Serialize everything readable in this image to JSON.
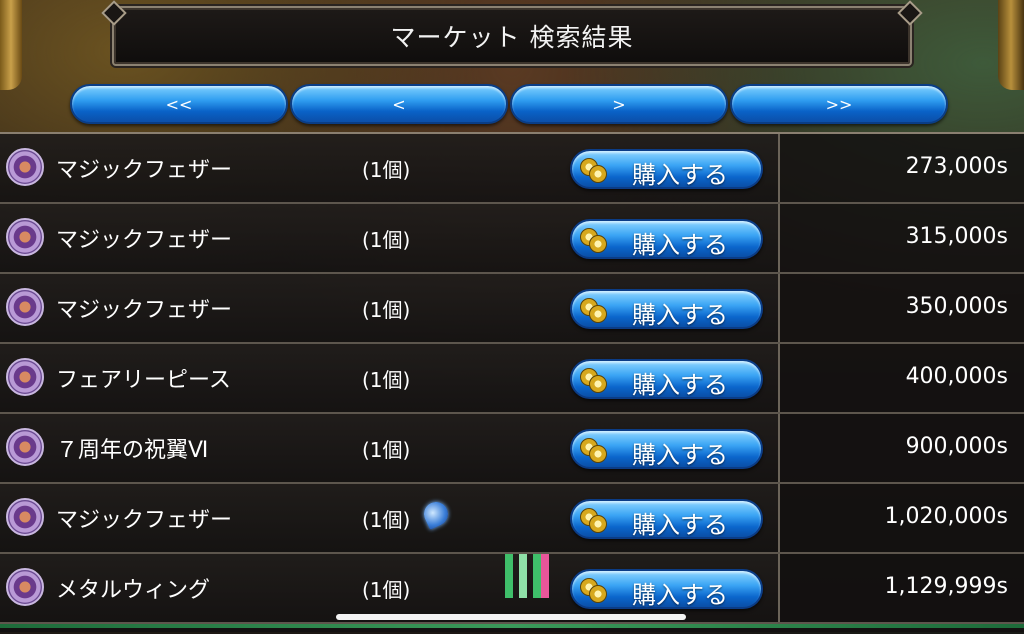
{
  "header": {
    "title": "マーケット 検索結果"
  },
  "pager": {
    "first": "<<",
    "prev": "<",
    "next": ">",
    "last": ">>"
  },
  "buy_label": "購入する",
  "items": [
    {
      "name": "マジックフェザー",
      "qty": "(1個)",
      "price": "273,000s"
    },
    {
      "name": "マジックフェザー",
      "qty": "(1個)",
      "price": "315,000s"
    },
    {
      "name": "マジックフェザー",
      "qty": "(1個)",
      "price": "350,000s"
    },
    {
      "name": "フェアリーピース",
      "qty": "(1個)",
      "price": "400,000s"
    },
    {
      "name": "７周年の祝翼Ⅵ",
      "qty": "(1個)",
      "price": "900,000s"
    },
    {
      "name": "マジックフェザー",
      "qty": "(1個)",
      "price": "1,020,000s"
    },
    {
      "name": "メタルウィング",
      "qty": "(1個)",
      "price": "1,129,999s"
    }
  ],
  "colors": {
    "accent_blue": "#2f9df0",
    "bar_green": "#3fbf6a",
    "bar_pink": "#e8569a"
  }
}
